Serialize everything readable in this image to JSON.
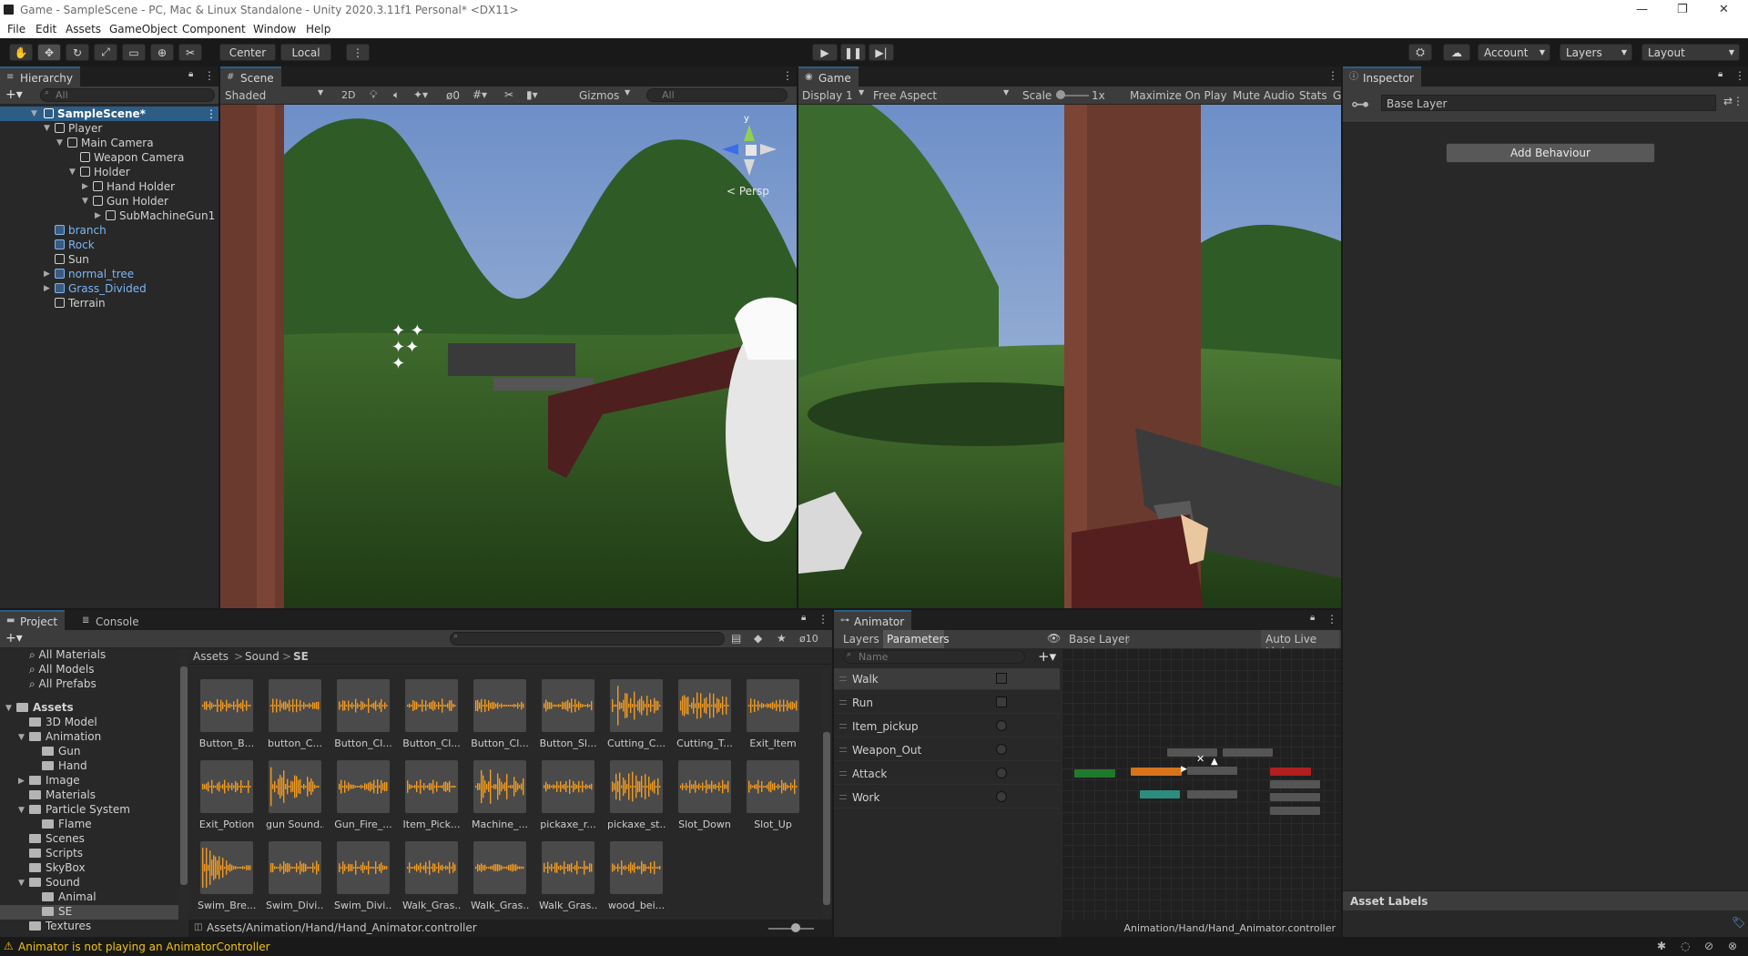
{
  "window": {
    "title": "Game - SampleScene - PC, Mac & Linux Standalone - Unity 2020.3.11f1 Personal* <DX11>",
    "minimize": "—",
    "maximize": "❐",
    "close": "✕"
  },
  "menu": [
    "File",
    "Edit",
    "Assets",
    "GameObject",
    "Component",
    "Window",
    "Help"
  ],
  "toolbar": {
    "center_label": "Center",
    "local_label": "Local",
    "account_label": "Account",
    "layers_label": "Layers",
    "layout_label": "Layout"
  },
  "hierarchy": {
    "tab": "Hierarchy",
    "search_placeholder": "All",
    "items": [
      "SampleScene*",
      "Player",
      "Main Camera",
      "Weapon Camera",
      "Holder",
      "Hand Holder",
      "Gun Holder",
      "SubMachineGun1",
      "branch",
      "Rock",
      "Sun",
      "normal_tree",
      "Grass_Divided",
      "Terrain"
    ]
  },
  "scene": {
    "tab": "Scene",
    "shading": "Shaded",
    "mode_2d": "2D",
    "hidden_count": "0",
    "gizmos": "Gizmos",
    "search_placeholder": "All",
    "persp": "< Persp",
    "axis_y": "y",
    "axis_x": "x",
    "axis_z": "z"
  },
  "game": {
    "tab": "Game",
    "display": "Display 1",
    "aspect": "Free Aspect",
    "scale_label": "Scale",
    "scale_value": "1x",
    "maximize": "Maximize On Play",
    "mute": "Mute Audio",
    "stats": "Stats",
    "gizmos_partial": "G"
  },
  "inspector": {
    "tab": "Inspector",
    "object_name": "Base Layer",
    "add_button": "Add Behaviour",
    "asset_labels": "Asset Labels"
  },
  "project": {
    "tab": "Project",
    "console_tab": "Console",
    "hidden_count": "10",
    "favorites": [
      "All Materials",
      "All Models",
      "All Prefabs"
    ],
    "folders": [
      "Assets",
      "3D Model",
      "Animation",
      "Gun",
      "Hand",
      "Image",
      "Materials",
      "Particle System",
      "Flame",
      "Scenes",
      "Scripts",
      "SkyBox",
      "Sound",
      "Animal",
      "SE",
      "Textures"
    ],
    "breadcrumb": [
      "Assets",
      "Sound",
      "SE"
    ],
    "assets": [
      "Button_B...",
      "button_C...",
      "Button_Cl...",
      "Button_Cl...",
      "Button_Cl...",
      "Button_Sl...",
      "Cutting_C...",
      "Cutting_T...",
      "Exit_Item",
      "Exit_Potion",
      "gun Sound...",
      "Gun_Fire_...",
      "Item_Pick...",
      "Machine_...",
      "pickaxe_r...",
      "pickaxe_st...",
      "Slot_Down",
      "Slot_Up",
      "Swim_Bre...",
      "Swim_Divi...",
      "Swim_Divi...",
      "Walk_Gras...",
      "Walk_Gras...",
      "Walk_Gras...",
      "wood_bei..."
    ],
    "footer_path": "Assets/Animation/Hand/Hand_Animator.controller"
  },
  "animator": {
    "tab": "Animator",
    "layers_tab": "Layers",
    "parameters_tab": "Parameters",
    "name_placeholder": "Name",
    "base_layer": "Base Layer",
    "auto_live_link": "Auto Live Link",
    "parameters": [
      {
        "name": "Walk",
        "kind": "bool"
      },
      {
        "name": "Run",
        "kind": "bool"
      },
      {
        "name": "Item_pickup",
        "kind": "trigger"
      },
      {
        "name": "Weapon_Out",
        "kind": "trigger"
      },
      {
        "name": "Attack",
        "kind": "trigger"
      },
      {
        "name": "Work",
        "kind": "trigger"
      }
    ],
    "footer_path": "Animation/Hand/Hand_Animator.controller"
  },
  "status": {
    "message": "Animator is not playing an AnimatorController"
  },
  "colors": {
    "accent_tab": "#2c5d87",
    "audio_wave": "#f39a1e",
    "warning": "#f0c30f",
    "selection": "#2c5d87"
  }
}
